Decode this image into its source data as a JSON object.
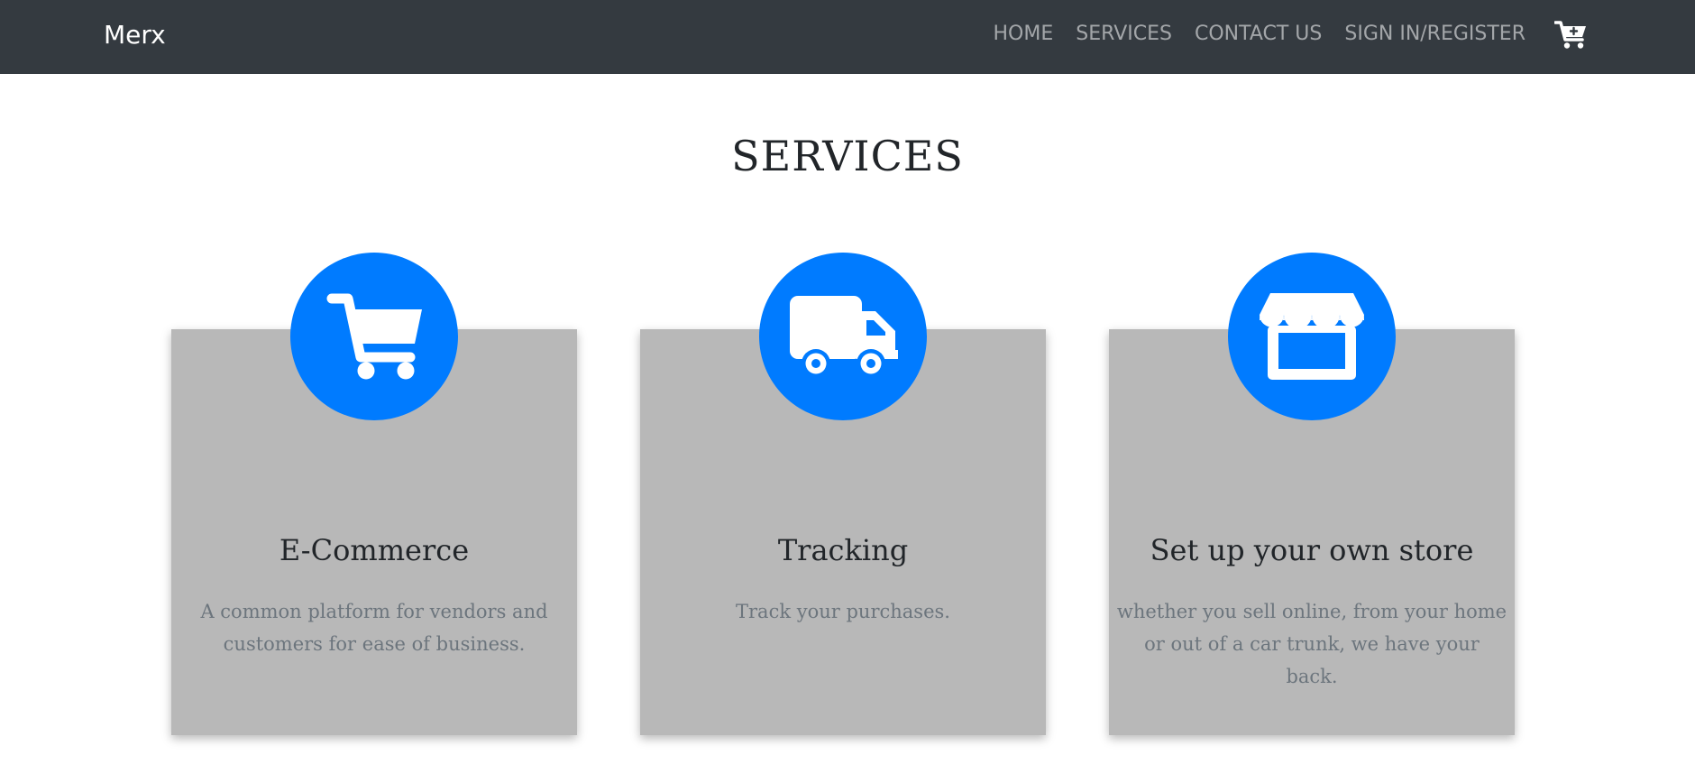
{
  "navbar": {
    "brand": "Merx",
    "links": [
      "HOME",
      "SERVICES",
      "CONTACT US",
      "SIGN IN/REGISTER"
    ],
    "cart_icon": "cart-plus-icon"
  },
  "page": {
    "title": "SERVICES"
  },
  "services": [
    {
      "icon": "shopping-cart-icon",
      "title": "E-Commerce",
      "text": "A common platform for vendors and customers for ease of business."
    },
    {
      "icon": "truck-icon",
      "title": "Tracking",
      "text": "Track your purchases."
    },
    {
      "icon": "store-icon",
      "title": "Set up your own store",
      "text": "whether you sell online, from your home or out of a car trunk, we have your back."
    }
  ],
  "colors": {
    "navbar_bg": "#343a40",
    "accent": "#007bff",
    "card_bg": "#b8b8b8"
  }
}
